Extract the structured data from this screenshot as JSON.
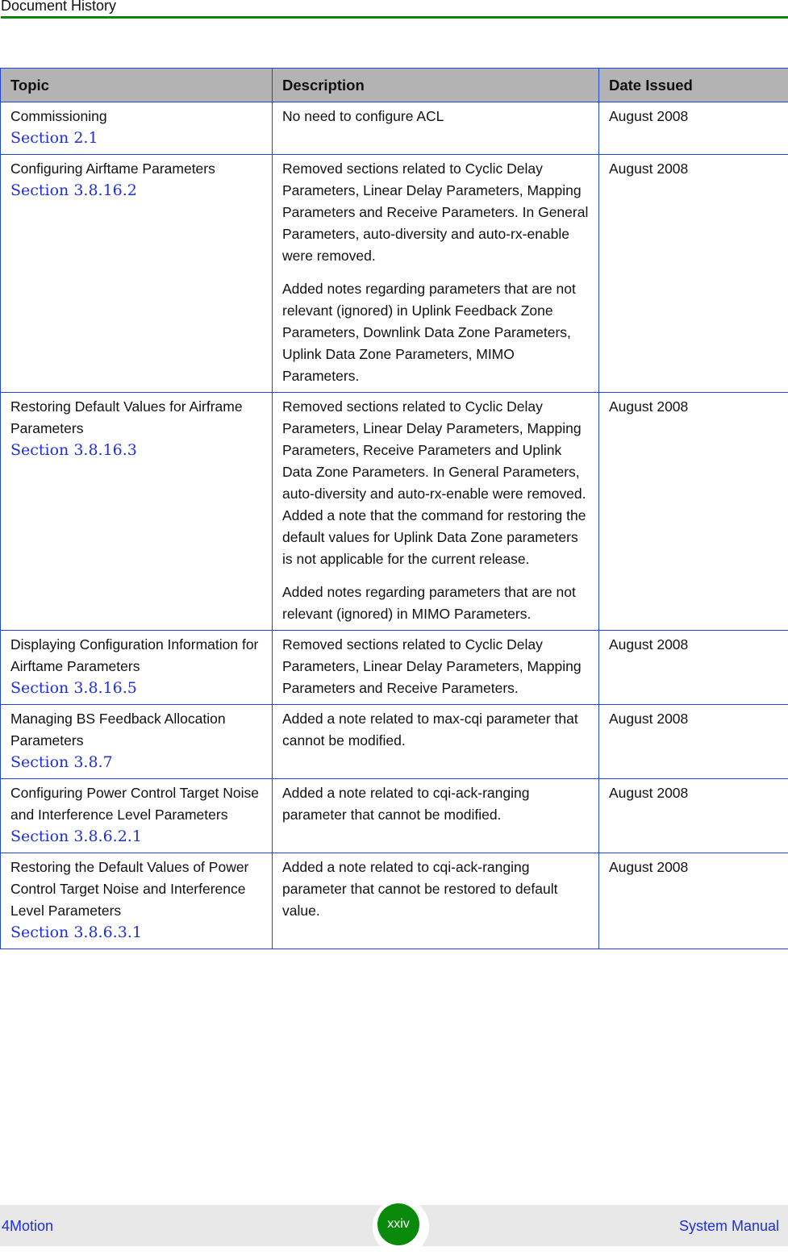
{
  "header": {
    "title": "Document History",
    "accent_color": "#0a8a0a"
  },
  "table": {
    "columns": [
      "Topic",
      "Description",
      "Date Issued"
    ],
    "rows": [
      {
        "topic": "Commissioning",
        "section": "Section 2.1",
        "description": [
          "No need to configure ACL"
        ],
        "date": "August 2008"
      },
      {
        "topic": "Configuring Airftame Parameters",
        "section": "Section 3.8.16.2",
        "description": [
          "Removed sections related to Cyclic Delay Parameters, Linear Delay Parameters, Mapping Parameters and Receive Parameters. In General Parameters, auto-diversity and auto-rx-enable were removed.",
          "Added notes regarding parameters that are not relevant (ignored) in Uplink Feedback Zone Parameters, Downlink Data Zone Parameters, Uplink Data Zone Parameters, MIMO Parameters."
        ],
        "date": "August 2008"
      },
      {
        "topic": "Restoring Default Values for Airframe Parameters",
        "section": "Section 3.8.16.3",
        "description": [
          "Removed sections related to Cyclic Delay Parameters, Linear Delay Parameters, Mapping Parameters, Receive Parameters and Uplink Data Zone Parameters. In General Parameters, auto-diversity and auto-rx-enable were removed. Added a note that the command for restoring the default values for Uplink Data Zone parameters is not applicable for the current release.",
          "Added notes regarding parameters that are not relevant (ignored) in MIMO Parameters."
        ],
        "date": "August 2008"
      },
      {
        "topic": "Displaying Configuration Information for Airftame Parameters",
        "section": "Section 3.8.16.5",
        "description": [
          "Removed sections related to Cyclic Delay Parameters, Linear Delay Parameters, Mapping Parameters and Receive Parameters."
        ],
        "date": "August 2008"
      },
      {
        "topic": "Managing BS Feedback Allocation Parameters",
        "section": "Section 3.8.7",
        "description": [
          "Added a note related to max-cqi parameter that cannot be modified."
        ],
        "date": "August 2008"
      },
      {
        "topic": "Configuring Power Control Target Noise and Interference Level Parameters",
        "section": "Section 3.8.6.2.1",
        "description": [
          "Added a note related to cqi-ack-ranging parameter that cannot be modified."
        ],
        "date": "August 2008"
      },
      {
        "topic": "Restoring the Default Values of Power Control Target Noise and Interference Level Parameters",
        "section": "Section 3.8.6.3.1",
        "description": [
          "Added a note related to cqi-ack-ranging parameter that cannot be restored to default value."
        ],
        "date": "August 2008"
      }
    ]
  },
  "footer": {
    "left": "4Motion",
    "page": "xxiv",
    "right": "System Manual",
    "link_color": "#1f2fe0"
  }
}
